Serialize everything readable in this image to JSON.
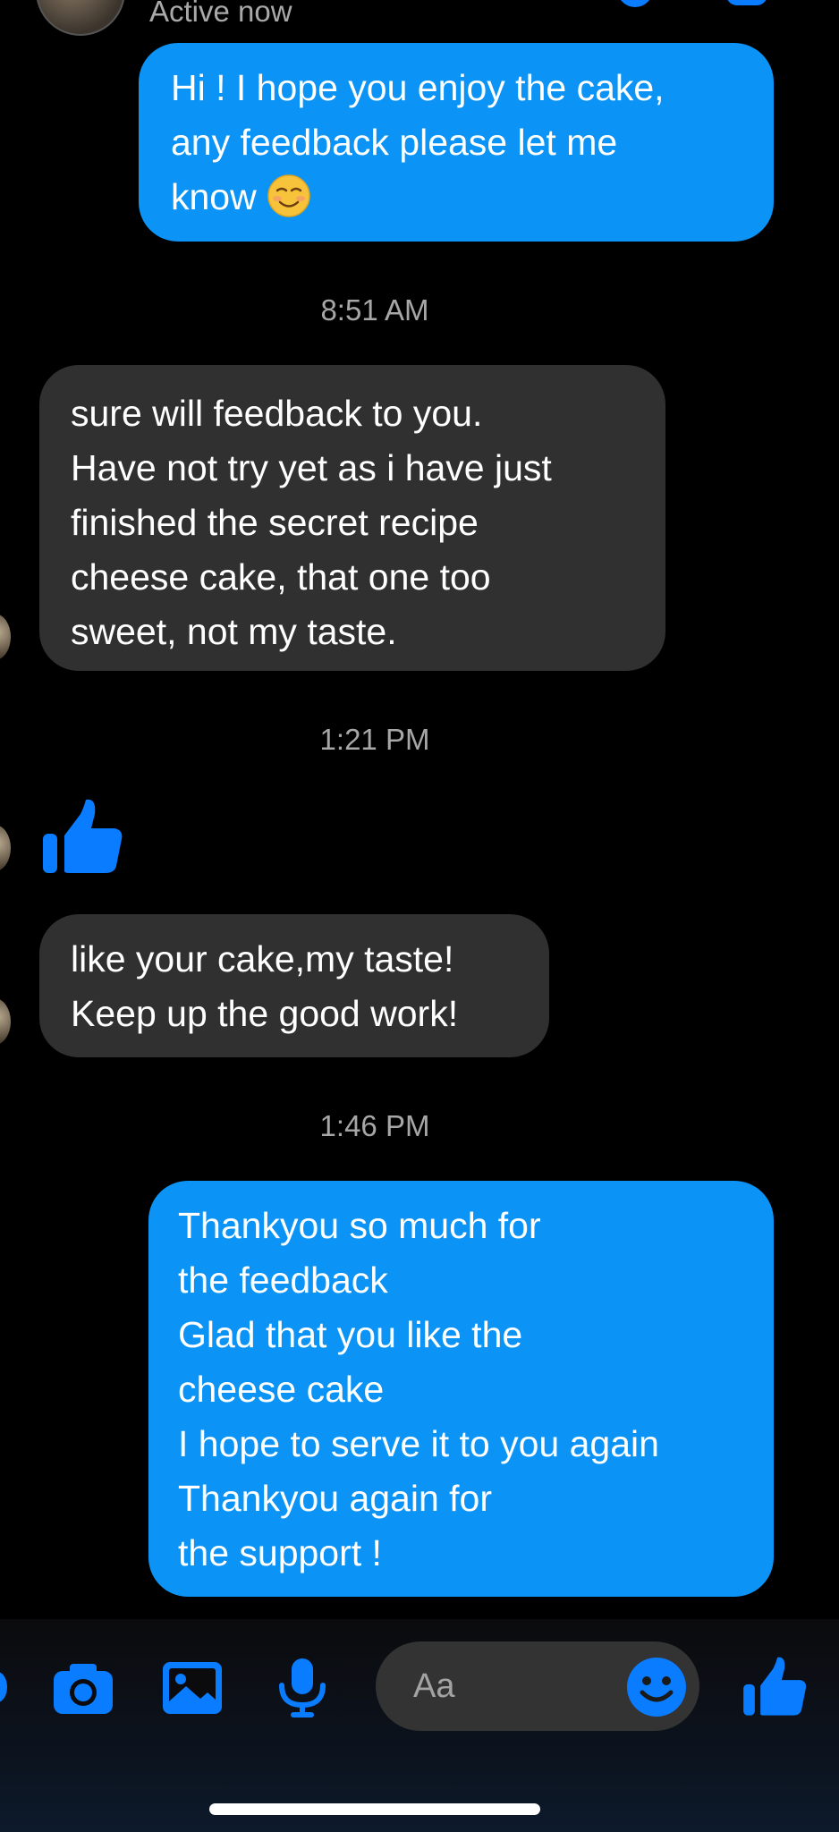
{
  "header": {
    "status": "Active now"
  },
  "messages": [
    {
      "id": "msg1",
      "direction": "outgoing",
      "text": "Hi ! I hope you enjoy the cake,\nany feedback please let me\nknow",
      "emoji": "smiling-face-emoji"
    },
    {
      "id": "ts1",
      "type": "timestamp",
      "text": "8:51 AM"
    },
    {
      "id": "msg2",
      "direction": "incoming",
      "text": "sure will feedback to you.\nHave not try yet as i have just\nfinished the secret recipe\ncheese cake, that one too\nsweet, not my taste."
    },
    {
      "id": "ts2",
      "type": "timestamp",
      "text": "1:21 PM"
    },
    {
      "id": "msg3",
      "direction": "incoming",
      "type": "like",
      "icon": "thumbs-up-icon"
    },
    {
      "id": "msg4",
      "direction": "incoming",
      "text": "like your cake,my taste!\nKeep up the good work!"
    },
    {
      "id": "ts3",
      "type": "timestamp",
      "text": "1:46 PM"
    },
    {
      "id": "msg5",
      "direction": "outgoing",
      "text": "Thankyou so much for\nthe feedback\nGlad that you like the\ncheese cake\nI hope to serve it to you again\nThankyou again for\nthe support !"
    }
  ],
  "composer": {
    "placeholder": "Aa",
    "icons": [
      "camera-icon",
      "photo-icon",
      "microphone-icon",
      "emoji-icon",
      "thumbs-up-icon"
    ]
  },
  "colors": {
    "accent": "#0a7cff",
    "outgoing_bubble": "#0b93f6",
    "incoming_bubble": "#303030",
    "background": "#000000",
    "timestamp": "#a7a7a7"
  }
}
